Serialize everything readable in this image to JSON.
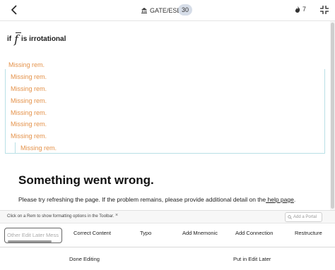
{
  "header": {
    "exam_tag": "GATE/ESE",
    "count": "30",
    "streak": "7"
  },
  "question": {
    "prefix": "if",
    "symbol": "f",
    "suffix": "is irrotational"
  },
  "missing_items": [
    "Missing rem.",
    "Missing rem.",
    "Missing rem.",
    "Missing rem.",
    "Missing rem.",
    "Missing rem.",
    "Missing rem.",
    "Missing rem."
  ],
  "error": {
    "title": "Something went wrong.",
    "message": "Please try refreshing the page. If the problem remains, please provide additional detail on the",
    "link": " help page",
    "end": "."
  },
  "hint_bar": {
    "text": "Click on a Rem to show formatting options in the Toolbar.",
    "close": "×",
    "portal_placeholder": "Add a Portal"
  },
  "toolbar": {
    "items": [
      "Other Edit Later Mess",
      "Correct Content",
      "Typo",
      "Add Mnemonic",
      "Add Connection",
      "Restructure"
    ]
  },
  "bottom": {
    "done": "Done Editing",
    "later": "Put in Edit Later"
  },
  "colors": {
    "missing": "#e4924a",
    "box_border": "#b9e0e6"
  }
}
